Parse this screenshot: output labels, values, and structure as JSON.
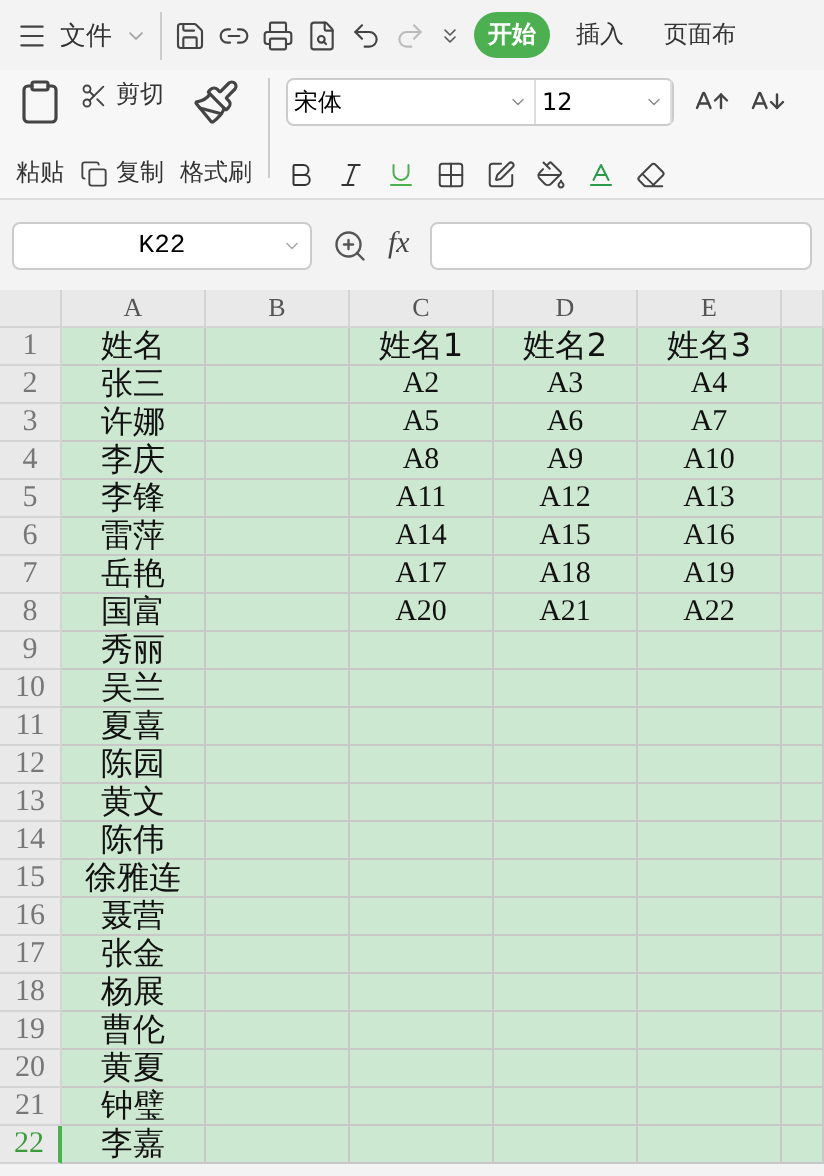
{
  "menu": {
    "file": "文件",
    "tabs": [
      {
        "label": "开始",
        "selected": true
      },
      {
        "label": "插入",
        "selected": false
      },
      {
        "label": "页面布",
        "selected": false
      }
    ]
  },
  "ribbon": {
    "paste": "粘贴",
    "cut": "剪切",
    "copy": "复制",
    "format_painter": "格式刷",
    "font": "宋体",
    "size": "12"
  },
  "formula_bar": {
    "name_box": "K22",
    "fx": "fx"
  },
  "columns": [
    "A",
    "B",
    "C",
    "D",
    "E"
  ],
  "rows": [
    {
      "number": "1",
      "selected": false,
      "cells": [
        "姓名",
        "",
        "姓名1",
        "姓名2",
        "姓名3"
      ]
    },
    {
      "number": "2",
      "selected": false,
      "cells": [
        "张三",
        "",
        "A2",
        "A3",
        "A4"
      ]
    },
    {
      "number": "3",
      "selected": false,
      "cells": [
        "许娜",
        "",
        "A5",
        "A6",
        "A7"
      ]
    },
    {
      "number": "4",
      "selected": false,
      "cells": [
        "李庆",
        "",
        "A8",
        "A9",
        "A10"
      ]
    },
    {
      "number": "5",
      "selected": false,
      "cells": [
        "李锋",
        "",
        "A11",
        "A12",
        "A13"
      ]
    },
    {
      "number": "6",
      "selected": false,
      "cells": [
        "雷萍",
        "",
        "A14",
        "A15",
        "A16"
      ]
    },
    {
      "number": "7",
      "selected": false,
      "cells": [
        "岳艳",
        "",
        "A17",
        "A18",
        "A19"
      ]
    },
    {
      "number": "8",
      "selected": false,
      "cells": [
        "国富",
        "",
        "A20",
        "A21",
        "A22"
      ]
    },
    {
      "number": "9",
      "selected": false,
      "cells": [
        "秀丽",
        "",
        "",
        "",
        ""
      ]
    },
    {
      "number": "10",
      "selected": false,
      "cells": [
        "吴兰",
        "",
        "",
        "",
        ""
      ]
    },
    {
      "number": "11",
      "selected": false,
      "cells": [
        "夏喜",
        "",
        "",
        "",
        ""
      ]
    },
    {
      "number": "12",
      "selected": false,
      "cells": [
        "陈园",
        "",
        "",
        "",
        ""
      ]
    },
    {
      "number": "13",
      "selected": false,
      "cells": [
        "黄文",
        "",
        "",
        "",
        ""
      ]
    },
    {
      "number": "14",
      "selected": false,
      "cells": [
        "陈伟",
        "",
        "",
        "",
        ""
      ]
    },
    {
      "number": "15",
      "selected": false,
      "cells": [
        "徐雅连",
        "",
        "",
        "",
        ""
      ]
    },
    {
      "number": "16",
      "selected": false,
      "cells": [
        "聂营",
        "",
        "",
        "",
        ""
      ]
    },
    {
      "number": "17",
      "selected": false,
      "cells": [
        "张金",
        "",
        "",
        "",
        ""
      ]
    },
    {
      "number": "18",
      "selected": false,
      "cells": [
        "杨展",
        "",
        "",
        "",
        ""
      ]
    },
    {
      "number": "19",
      "selected": false,
      "cells": [
        "曹伦",
        "",
        "",
        "",
        ""
      ]
    },
    {
      "number": "20",
      "selected": false,
      "cells": [
        "黄夏",
        "",
        "",
        "",
        ""
      ]
    },
    {
      "number": "21",
      "selected": false,
      "cells": [
        "钟璧",
        "",
        "",
        "",
        ""
      ]
    },
    {
      "number": "22",
      "selected": true,
      "cells": [
        "李嘉",
        "",
        "",
        "",
        ""
      ]
    }
  ]
}
